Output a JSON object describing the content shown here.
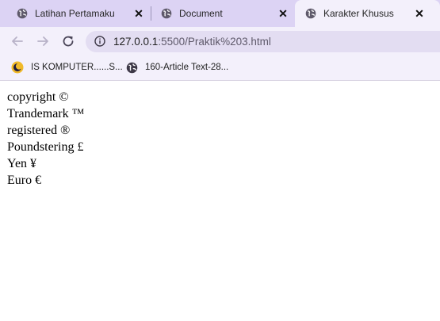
{
  "browser": {
    "tabs": [
      {
        "title": "Latihan Pertamaku",
        "active": false
      },
      {
        "title": "Document",
        "active": false
      },
      {
        "title": "Karakter Khusus",
        "active": true
      }
    ],
    "address_bar": {
      "host": "127.0.0.1",
      "path": ":5500/Praktik%203.html"
    },
    "bookmarks": [
      {
        "label": "IS KOMPUTER......S...",
        "icon": "moon-logo-icon"
      },
      {
        "label": "160-Article Text-28...",
        "icon": "globe-icon"
      }
    ],
    "colors": {
      "tab_strip": "#dcd3f4",
      "toolbar": "#f3f0fb",
      "omnibox": "#e3ddf2"
    }
  },
  "page": {
    "lines": [
      "copyright ©",
      "Trandemark ™",
      "registered ®",
      "Poundstering £",
      "Yen ¥",
      "Euro €"
    ]
  }
}
